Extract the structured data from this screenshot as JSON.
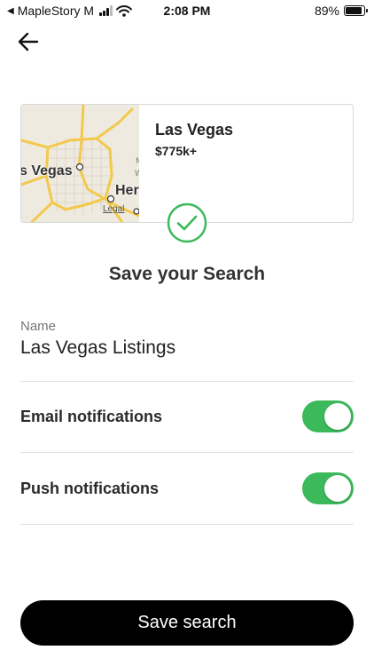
{
  "status_bar": {
    "back_app_label": "MapleStory M",
    "time": "2:08 PM",
    "battery_percent_label": "89%",
    "battery_level": 0.89,
    "signal_bars": 3
  },
  "back_button": {
    "icon": "arrow-left-icon"
  },
  "search_card": {
    "map": {
      "city_label": "s Vegas",
      "neighbor_label": "Her",
      "legal_label": "Legal",
      "road_color": "#f2c94c"
    },
    "title": "Las Vegas",
    "price": "$775k+",
    "check_color": "#3cb95b"
  },
  "heading": "Save your Search",
  "name_field": {
    "label": "Name",
    "value": "Las Vegas Listings"
  },
  "toggles": [
    {
      "label": "Email notifications",
      "on": true
    },
    {
      "label": "Push notifications",
      "on": true
    }
  ],
  "accent_color": "#3cb95b",
  "save_button_label": "Save search"
}
